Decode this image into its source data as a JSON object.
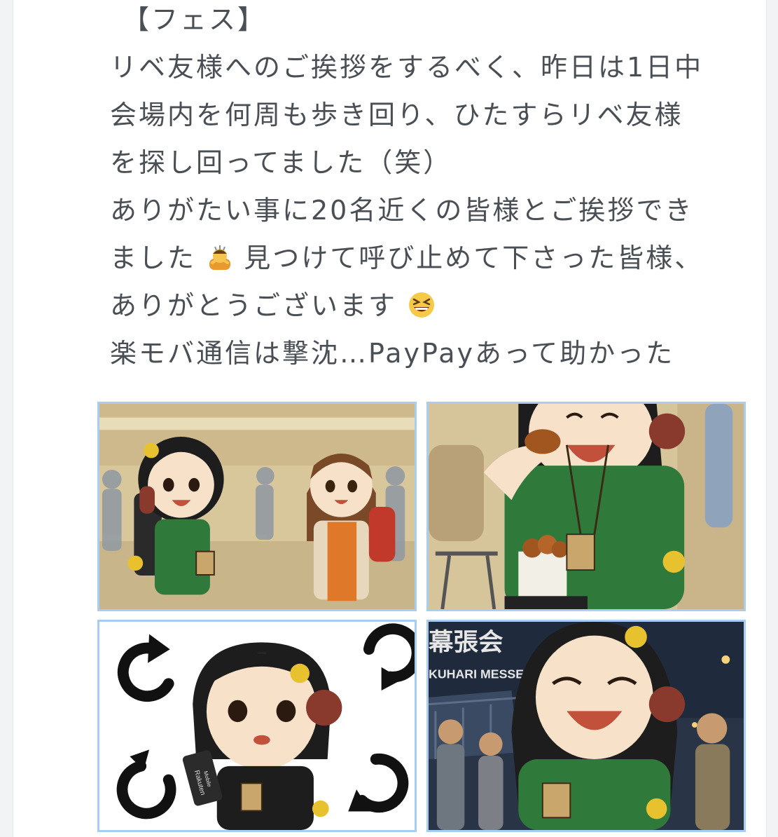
{
  "post": {
    "lines": [
      "【フェス】",
      "リベ友様へのご挨拶をするべく、昨日は1日中",
      "会場内を何周も歩き回り、ひたすらリベ友様",
      "を探し回ってました（笑）",
      "ありがたい事に20名近くの皆様とご挨拶でき",
      "ました",
      "見つけて呼び止めて下さった皆様、",
      "ありがとうございます",
      "楽モバ通信は撃沈…PayPayあって助かった"
    ],
    "emojis": [
      "person-bowing-emoji",
      "grinning-squinting-face-emoji"
    ]
  },
  "images": {
    "count": 4,
    "signage": {
      "sign_jp": "幕張会",
      "sign_en": "KUHARI MESSE",
      "phone_brand": "Rakuten",
      "phone_sub": "Mobile"
    }
  },
  "colors": {
    "text": "#4a4f55",
    "image_border": "#a9cdf2",
    "shirt_green": "#2f7a3a",
    "night_blue": "#1f2a3d"
  }
}
